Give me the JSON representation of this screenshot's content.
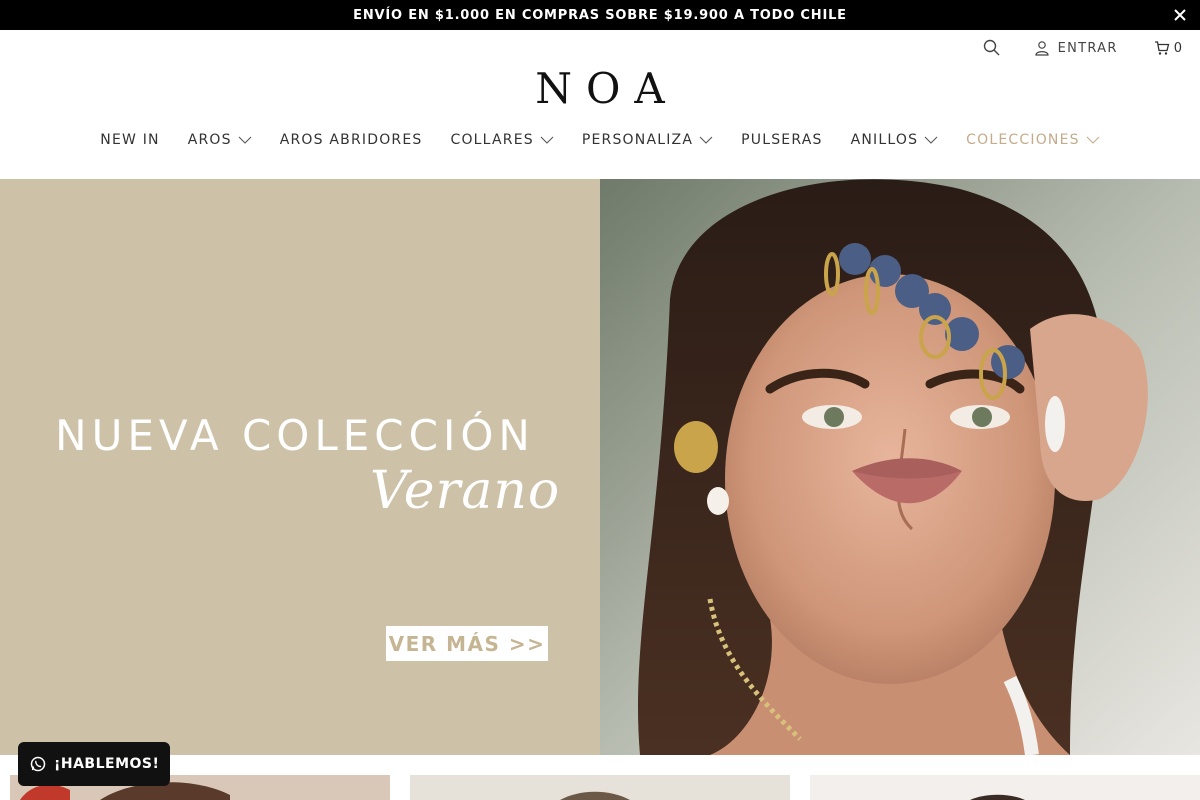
{
  "announcement": {
    "text": "ENVÍO EN $1.000 EN COMPRAS SOBRE $19.900 A TODO CHILE"
  },
  "header": {
    "logo": "NOA",
    "login_label": "ENTRAR",
    "cart_count": "0",
    "icons": {
      "search": "search-icon",
      "login": "user-icon",
      "cart": "cart-icon",
      "close": "close-icon"
    }
  },
  "nav": {
    "items": [
      {
        "label": "NEW IN",
        "dropdown": false
      },
      {
        "label": "AROS",
        "dropdown": true
      },
      {
        "label": "AROS ABRIDORES",
        "dropdown": false
      },
      {
        "label": "COLLARES",
        "dropdown": true
      },
      {
        "label": "PERSONALIZA",
        "dropdown": true
      },
      {
        "label": "PULSERAS",
        "dropdown": false
      },
      {
        "label": "ANILLOS",
        "dropdown": true
      },
      {
        "label": "COLECCIONES",
        "dropdown": true,
        "active": true
      }
    ]
  },
  "hero": {
    "title": "NUEVA COLECCIÓN",
    "script": "Verano",
    "cta": "VER MÁS >>"
  },
  "chat": {
    "label": "¡HABLEMOS!",
    "icon": "whatsapp-icon"
  },
  "colors": {
    "hero_bg": "#cdc2a8",
    "accent": "#c4ab8a",
    "announce_bg": "#000000"
  }
}
